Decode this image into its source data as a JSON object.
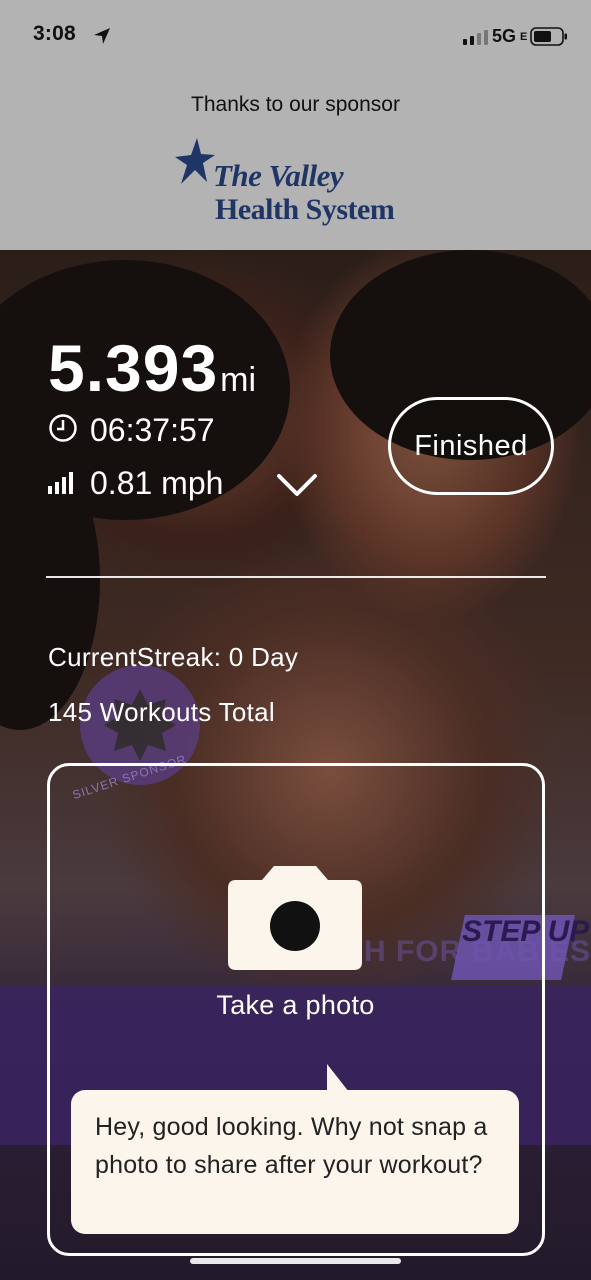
{
  "status_bar": {
    "time": "3:08",
    "network": "5G",
    "network_suffix": "E",
    "icons": [
      "location-arrow-icon",
      "cellular-signal-icon",
      "battery-icon"
    ]
  },
  "sponsor": {
    "text": "Thanks to our sponsor",
    "logo_line1": "The Valley",
    "logo_line2": "Health System",
    "logo_color": "#1f3566"
  },
  "workout": {
    "distance_value": "5.393",
    "distance_unit": "mi",
    "duration": "06:37:57",
    "speed": "0.81 mph",
    "finished_label": "Finished"
  },
  "streak": {
    "current": "CurrentStreak: 0 Day",
    "total": "145 Workouts Total"
  },
  "photo_card": {
    "button_label": "Take a photo",
    "tooltip": "Hey, good looking. Why not snap a photo to share after your workout?"
  },
  "background": {
    "badge_text": "SILVER SPONSOR",
    "march_text": "MARCH FOR BABIES",
    "step_up_text": "STEP UP"
  },
  "colors": {
    "sponsor_bg": "#b3b3b3",
    "text_on_photo": "#ffffff",
    "tooltip_bg": "#fbf5ec"
  }
}
